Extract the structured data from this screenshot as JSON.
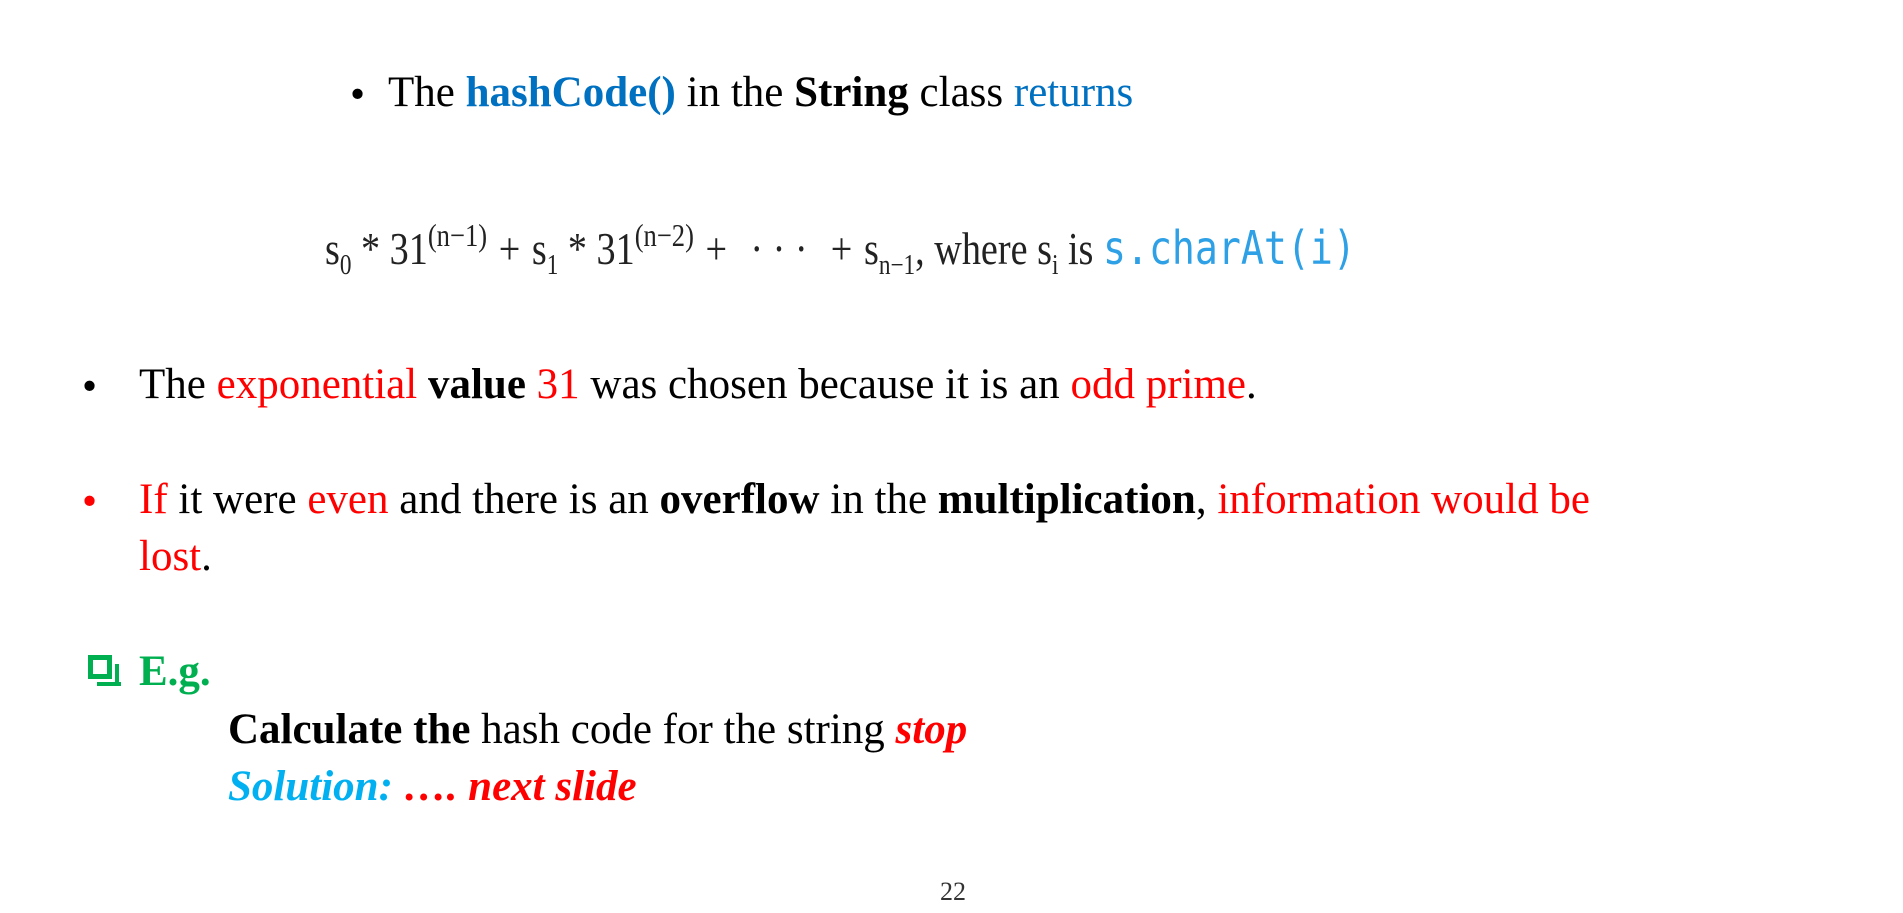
{
  "bullet_symbol": "•",
  "intro": {
    "t1": "The ",
    "t2": "hashCode()",
    "t3": " in the ",
    "t4": "String",
    "t5": " class ",
    "t6": "returns"
  },
  "formula": {
    "s": "s",
    "sub0": "0",
    "times": " * 31",
    "exp1": "(n−1)",
    "plus": "+",
    "sub1": "1",
    "exp2": "(n−2)",
    "dots": "· · ·",
    "subn": "n−1",
    "where": ", where s",
    "subi": "i",
    "is": " is ",
    "code": "s.charAt(i)"
  },
  "point1": {
    "t1": "The ",
    "t2": "exponential",
    "t3": " ",
    "t4": "value",
    "t5": " ",
    "t6": "31",
    "t7": " was chosen because it is an ",
    "t8": "odd prime",
    "t9": "."
  },
  "point2": {
    "t1": "If",
    "t2": " it were ",
    "t3": "even",
    "t4": " and there is an ",
    "t5": "overflow",
    "t6": " in the  ",
    "t7": "multiplication",
    "t8": ", ",
    "t9": "information would be",
    "t10": "lost",
    "t11": "."
  },
  "example": {
    "label": "E.g.",
    "calc_bold": "Calculate the",
    "calc_text": " hash code for the string ",
    "calc_word": "stop",
    "solution_label": "Solution:",
    "solution_rest": " …. next slide"
  },
  "page_number": "22",
  "colors": {
    "blue": "#0070c0",
    "red": "#ff0000",
    "green": "#00b050",
    "cyan": "#00b0f0"
  }
}
